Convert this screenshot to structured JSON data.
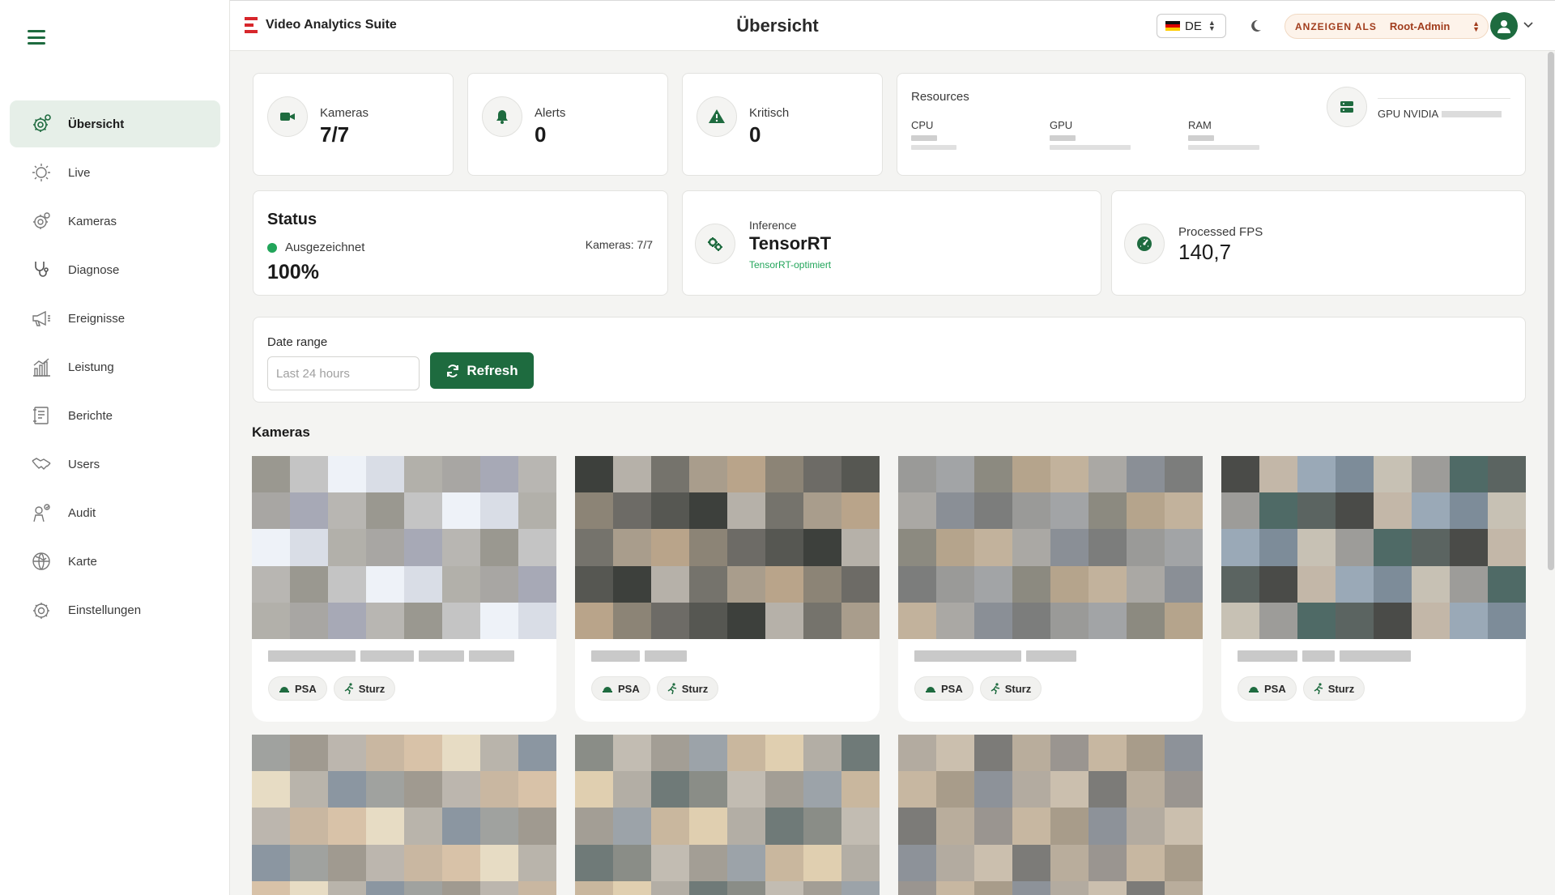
{
  "header": {
    "app_name": "Video Analytics Suite",
    "page_title": "Übersicht",
    "language": "DE",
    "view_as_label": "ANZEIGEN ALS",
    "view_as_value": "Root-Admin"
  },
  "sidebar": {
    "items": [
      {
        "label": "Übersicht",
        "icon": "overview-gear-icon",
        "active": true
      },
      {
        "label": "Live",
        "icon": "live-sun-icon"
      },
      {
        "label": "Kameras",
        "icon": "cameras-gear-icon"
      },
      {
        "label": "Diagnose",
        "icon": "stethoscope-icon"
      },
      {
        "label": "Ereignisse",
        "icon": "megaphone-icon"
      },
      {
        "label": "Leistung",
        "icon": "bar-chart-icon"
      },
      {
        "label": "Berichte",
        "icon": "report-icon"
      },
      {
        "label": "Users",
        "icon": "handshake-icon"
      },
      {
        "label": "Audit",
        "icon": "audit-person-icon"
      },
      {
        "label": "Karte",
        "icon": "globe-icon"
      },
      {
        "label": "Einstellungen",
        "icon": "settings-icon"
      }
    ]
  },
  "stats": {
    "cameras": {
      "label": "Kameras",
      "value": "7/7"
    },
    "alerts": {
      "label": "Alerts",
      "value": "0"
    },
    "critical": {
      "label": "Kritisch",
      "value": "0"
    }
  },
  "resources": {
    "title": "Resources",
    "cpu_label": "CPU",
    "gpu_label": "GPU",
    "ram_label": "RAM",
    "gpu_name": "GPU NVIDIA"
  },
  "status": {
    "title": "Status",
    "state": "Ausgezeichnet",
    "percent": "100%",
    "cameras": "Kameras: 7/7"
  },
  "inference": {
    "label": "Inference",
    "engine": "TensorRT",
    "note": "TensorRT-optimiert"
  },
  "fps": {
    "label": "Processed FPS",
    "value": "140,7"
  },
  "date_range": {
    "label": "Date range",
    "placeholder": "Last 24 hours",
    "refresh_label": "Refresh"
  },
  "cameras_section": {
    "title": "Kameras",
    "tag_psa": "PSA",
    "tag_fall": "Sturz"
  },
  "colors": {
    "primary": "#1e6b3f",
    "active_bg": "#e6efe8",
    "brand_red": "#d7262b",
    "view_as_text": "#a13d1d",
    "status_green": "#22a55a"
  }
}
